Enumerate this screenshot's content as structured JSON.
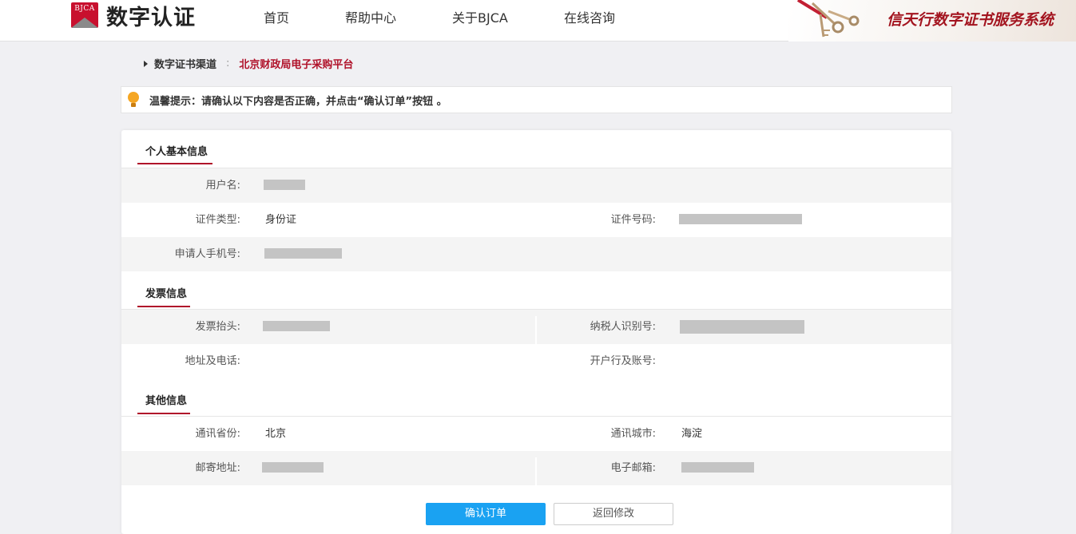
{
  "header": {
    "logo_badge": "BJCA",
    "logo_text": "数字认证",
    "nav": [
      "首页",
      "帮助中心",
      "关于BJCA",
      "在线咨询"
    ],
    "banner_title": "信天行数字证书服务系统"
  },
  "breadcrumb": {
    "label": "数字证书渠道",
    "separator": ":",
    "channel": "北京财政局电子采购平台"
  },
  "tip": {
    "text": "温馨提示：请确认以下内容是否正确，并点击“确认订单”按钮 。"
  },
  "sections": {
    "personal": {
      "title": "个人基本信息",
      "username_label": "用户名:",
      "id_type_label": "证件类型:",
      "id_type_value": "身份证",
      "id_number_label": "证件号码:",
      "phone_label": "申请人手机号:"
    },
    "invoice": {
      "title": "发票信息",
      "title_label": "发票抬头:",
      "taxpayer_label": "纳税人识别号:",
      "address_label": "地址及电话:",
      "bank_label": "开户行及账号:"
    },
    "other": {
      "title": "其他信息",
      "province_label": "通讯省份:",
      "province_value": "北京",
      "city_label": "通讯城市:",
      "city_value": "海淀",
      "mail_label": "邮寄地址:",
      "email_label": "电子邮箱:"
    }
  },
  "buttons": {
    "confirm": "确认订单",
    "back": "返回修改"
  },
  "colors": {
    "brand_red": "#b0122a",
    "primary_blue": "#1aa2f2",
    "tip_icon": "#f5a623"
  }
}
